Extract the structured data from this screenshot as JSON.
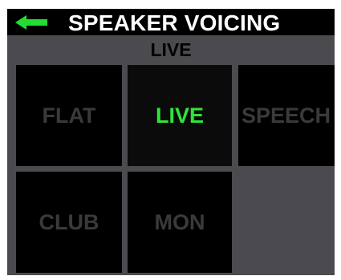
{
  "header": {
    "title": "SPEAKER VOICING",
    "back_icon": "back-arrow-icon",
    "back_icon_color": "#22dd33"
  },
  "current_voicing": "LIVE",
  "voicings": [
    {
      "label": "FLAT",
      "active": false
    },
    {
      "label": "LIVE",
      "active": true
    },
    {
      "label": "SPEECH",
      "active": false
    },
    {
      "label": "CLUB",
      "active": false
    },
    {
      "label": "MON",
      "active": false
    }
  ],
  "colors": {
    "active_text": "#2fe43a",
    "inactive_text": "#3a3a3a",
    "background": "#4b4b4f",
    "tile": "#000000"
  }
}
